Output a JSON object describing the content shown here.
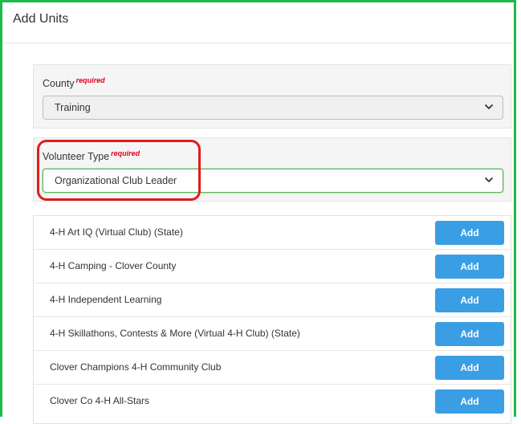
{
  "panel": {
    "title": "Add Units"
  },
  "county": {
    "label": "County",
    "required": "required",
    "value": "Training"
  },
  "volunteer_type": {
    "label": "Volunteer Type",
    "required": "required",
    "value": "Organizational Club Leader"
  },
  "units": [
    {
      "name": "4-H Art IQ (Virtual Club) (State)",
      "button": "Add"
    },
    {
      "name": "4-H Camping - Clover County",
      "button": "Add"
    },
    {
      "name": "4-H Independent Learning",
      "button": "Add"
    },
    {
      "name": "4-H Skillathons, Contests & More (Virtual 4-H Club) (State)",
      "button": "Add"
    },
    {
      "name": "Clover Champions 4-H Community Club",
      "button": "Add"
    },
    {
      "name": "Clover Co 4-H All-Stars",
      "button": "Add"
    }
  ],
  "colors": {
    "frame": "#1db94a",
    "highlight": "#e21b1b",
    "button": "#3a9ee4",
    "required": "#e0001b"
  },
  "icons": {
    "select_arrow": "chevron-down-icon"
  }
}
